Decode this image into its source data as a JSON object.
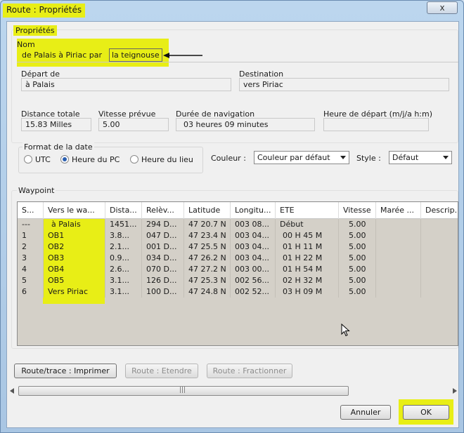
{
  "window": {
    "title": "Route : Propriétés",
    "close_glyph": "x"
  },
  "properties": {
    "group_label": "Propriétés",
    "nom_label": "Nom",
    "nom_value_part1": "de Palais à Piriac par ",
    "nom_value_part2": "la teignouse",
    "depart_label": "Départ de",
    "depart_value": "à Palais",
    "destination_label": "Destination",
    "destination_value": "vers Piriac",
    "distance_label": "Distance totale",
    "distance_value": "15.83 Milles",
    "vitesse_label": "Vitesse prévue",
    "vitesse_value": "5.00",
    "duree_label": "Durée de navigation",
    "duree_value": "03 heures  09 minutes",
    "heure_label": "Heure de départ (m/j/a h:m)",
    "heure_value": ""
  },
  "date_format": {
    "label": "Format de la date",
    "options": [
      "UTC",
      "Heure du PC",
      "Heure du lieu"
    ],
    "selected": "Heure du PC"
  },
  "couleur": {
    "label": "Couleur :",
    "value": "Couleur par défaut"
  },
  "style": {
    "label": "Style :",
    "value": "Défaut"
  },
  "waypoints": {
    "label": "Waypoint",
    "columns": [
      "S...",
      "Vers le wa...",
      "Dista...",
      "Relèv...",
      "Latitude",
      "Longitu...",
      "ETE",
      "Vitesse",
      "Marée ...",
      "Descrip..."
    ],
    "rows": [
      [
        "---",
        "à Palais",
        "1451...",
        "294 D...",
        "47 20.7 N",
        "003 08...",
        "Début",
        "5.00",
        "",
        ""
      ],
      [
        "1",
        "OB1",
        "3.8...",
        "047 D...",
        "47 23.4 N",
        "003 04...",
        "00 H  45 M",
        "5.00",
        "",
        ""
      ],
      [
        "2",
        "OB2",
        "2.1...",
        "001 D...",
        "47 25.5 N",
        "003 04...",
        "01 H  11 M",
        "5.00",
        "",
        ""
      ],
      [
        "3",
        "OB3",
        "0.9...",
        "034 D...",
        "47 26.2 N",
        "003 04...",
        "01 H  22 M",
        "5.00",
        "",
        ""
      ],
      [
        "4",
        "OB4",
        "2.6...",
        "070 D...",
        "47 27.2 N",
        "003 00...",
        "01 H  54 M",
        "5.00",
        "",
        ""
      ],
      [
        "5",
        "OB5",
        "3.1...",
        "126 D...",
        "47 25.3 N",
        "002 56...",
        "02 H  32 M",
        "5.00",
        "",
        ""
      ],
      [
        "6",
        "Vers Piriac",
        "3.1...",
        "100 D...",
        "47 24.8 N",
        "002 52...",
        "03 H  09 M",
        "5.00",
        "",
        ""
      ]
    ]
  },
  "buttons": {
    "print": "Route/trace : Imprimer",
    "extend": "Route : Etendre",
    "split": "Route : Fractionner",
    "cancel": "Annuler",
    "ok": "OK"
  },
  "icons": {
    "arrow": "arrow-left-icon",
    "cursor": "mouse-cursor-icon",
    "scroll_grip": "|||"
  },
  "colors": {
    "highlight": "#e8ee16",
    "grid_bg": "#d4d0c8",
    "radio_dot": "#2a5fb0"
  }
}
